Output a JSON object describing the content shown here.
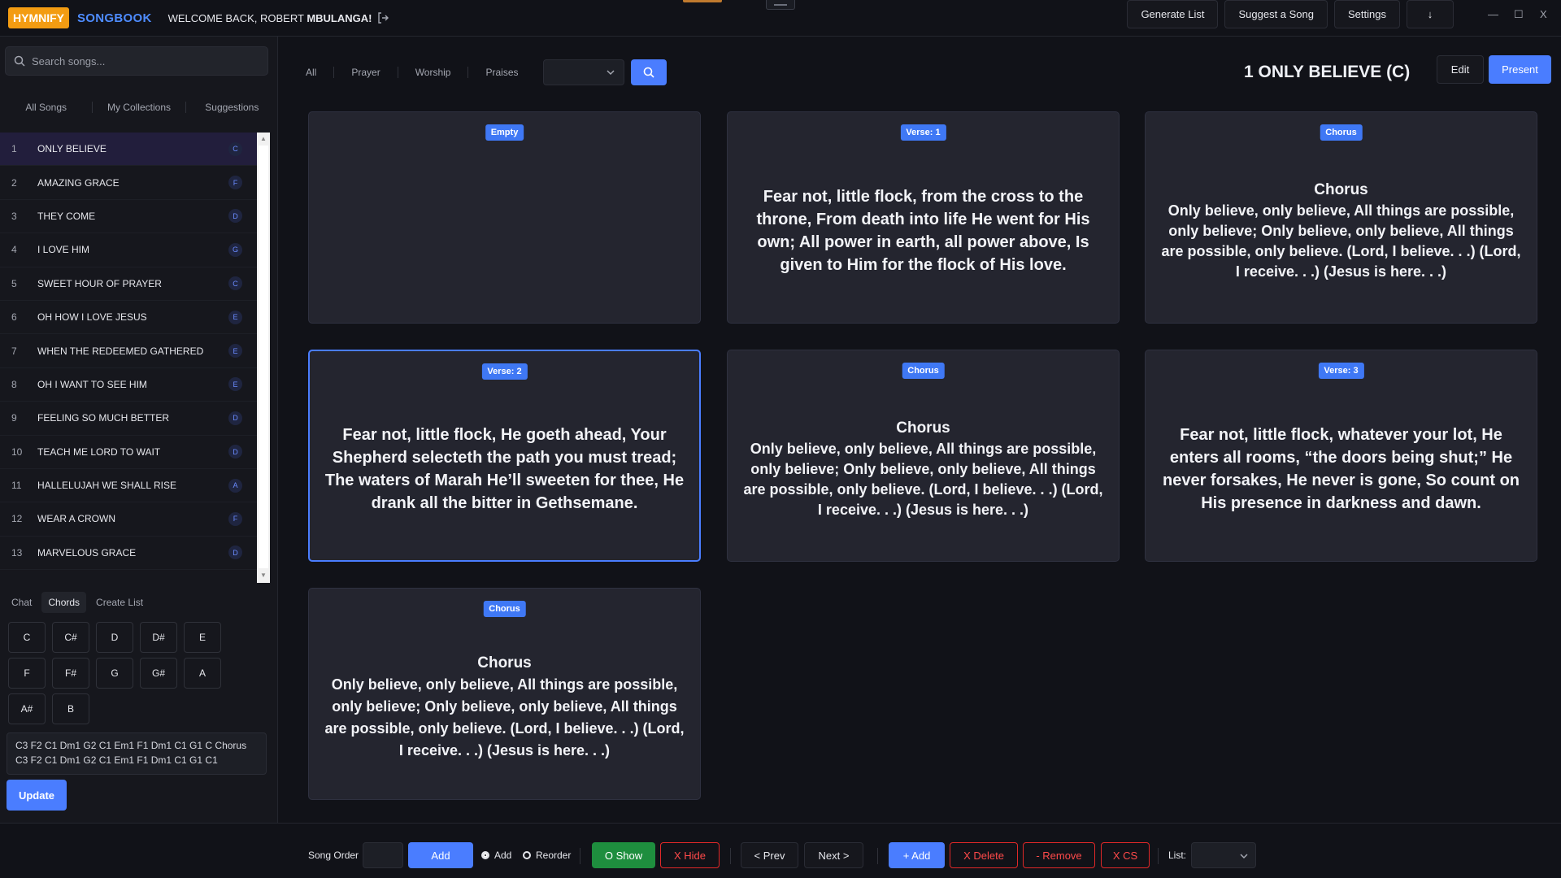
{
  "header": {
    "logo": "HYMNIFY",
    "app_name": "SONGBOOK",
    "welcome_prefix": "WELCOME BACK, ROBERT ",
    "welcome_name": "MBULANGA!",
    "buttons": {
      "generate_list": "Generate List",
      "suggest_song": "Suggest a Song",
      "settings": "Settings",
      "download": "↓"
    },
    "window": {
      "minimize": "—",
      "maximize": "☐",
      "close": "X"
    }
  },
  "sidebar": {
    "search_placeholder": "Search songs...",
    "tabs": [
      "All Songs",
      "My Collections",
      "Suggestions"
    ],
    "songs": [
      {
        "num": "1",
        "title": "ONLY BELIEVE",
        "key": "C"
      },
      {
        "num": "2",
        "title": "AMAZING GRACE",
        "key": "F"
      },
      {
        "num": "3",
        "title": "THEY COME",
        "key": "D"
      },
      {
        "num": "4",
        "title": "I LOVE HIM",
        "key": "G"
      },
      {
        "num": "5",
        "title": "SWEET HOUR OF PRAYER",
        "key": "C"
      },
      {
        "num": "6",
        "title": "OH HOW I LOVE JESUS",
        "key": "E"
      },
      {
        "num": "7",
        "title": "WHEN THE REDEEMED GATHERED",
        "key": "E"
      },
      {
        "num": "8",
        "title": "OH I WANT TO SEE HIM",
        "key": "E"
      },
      {
        "num": "9",
        "title": "FEELING SO MUCH BETTER",
        "key": "D"
      },
      {
        "num": "10",
        "title": "TEACH ME LORD TO WAIT",
        "key": "D"
      },
      {
        "num": "11",
        "title": "HALLELUJAH WE SHALL RISE",
        "key": "A"
      },
      {
        "num": "12",
        "title": "WEAR A CROWN",
        "key": "F"
      },
      {
        "num": "13",
        "title": "MARVELOUS GRACE",
        "key": "D"
      }
    ],
    "panel_tabs": [
      "Chat",
      "Chords",
      "Create List"
    ],
    "chords": [
      "C",
      "C#",
      "D",
      "D#",
      "E",
      "F",
      "F#",
      "G",
      "G#",
      "A",
      "A#",
      "B"
    ],
    "chord_text_line1": "C3 F2 C1 Dm1 G2 C1 Em1 F1 Dm1 C1 G1 C Chorus",
    "chord_text_line2": "C3 F2 C1 Dm1 G2 C1 Em1 F1 Dm1 C1 G1 C1",
    "update_label": "Update"
  },
  "main": {
    "filters": [
      "All",
      "Prayer",
      "Worship",
      "Praises"
    ],
    "song_heading": "1 ONLY BELIEVE (C)",
    "edit_label": "Edit",
    "present_label": "Present",
    "cards": [
      {
        "badge": "Empty",
        "title": "",
        "text": ""
      },
      {
        "badge": "Verse: 1",
        "title": "",
        "text": "Fear not, little flock, from the cross to the throne, From death into life He went for His own; All power in earth, all power above, Is given to Him for the flock of His love."
      },
      {
        "badge": "Chorus",
        "title": "Chorus",
        "text": "Only believe, only believe, All things are possible, only believe; Only believe, only believe, All things are possible, only believe. (Lord, I believe. . .) (Lord, I receive. . .) (Jesus is here. . .)"
      },
      {
        "badge": "Verse: 2",
        "title": "",
        "text": "Fear not, little flock, He goeth ahead, Your Shepherd selecteth the path you must tread; The waters of Marah He’ll sweeten for thee, He drank all the bitter in Gethsemane."
      },
      {
        "badge": "Chorus",
        "title": "Chorus",
        "text": "Only believe, only believe, All things are possible, only believe; Only believe, only believe, All things are possible, only believe. (Lord, I believe. . .) (Lord, I receive. . .) (Jesus is here. . .)"
      },
      {
        "badge": "Verse: 3",
        "title": "",
        "text": "Fear not, little flock, whatever your lot, He enters all rooms, “the doors being shut;” He never forsakes, He never is gone, So count on His presence in darkness and dawn."
      },
      {
        "badge": "Chorus",
        "title": "Chorus",
        "text": "Only believe, only believe, All things are possible, only believe; Only believe, only believe, All things are possible, only believe. (Lord, I believe. . .) (Lord, I receive. . .) (Jesus is here. . .)"
      }
    ]
  },
  "footer": {
    "song_order_label": "Song Order",
    "add_label": "Add",
    "radio_add": "Add",
    "radio_reorder": "Reorder",
    "show_label": "O Show",
    "hide_label": "X Hide",
    "prev_label": "< Prev",
    "next_label": "Next >",
    "plus_add_label": "+ Add",
    "delete_label": "X Delete",
    "remove_label": "- Remove",
    "cs_label": "X CS",
    "list_label": "List:"
  }
}
